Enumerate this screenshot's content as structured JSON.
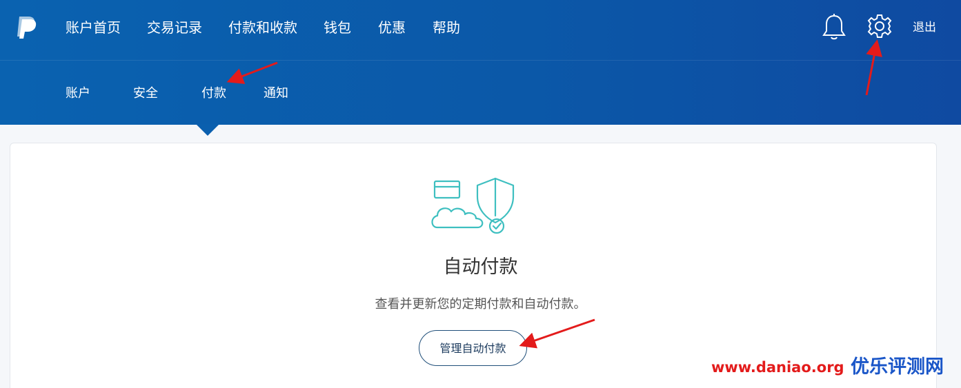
{
  "brand": {
    "logo_icon": "paypal-logo-icon"
  },
  "main_nav": [
    {
      "label": "账户首页"
    },
    {
      "label": "交易记录"
    },
    {
      "label": "付款和收款"
    },
    {
      "label": "钱包"
    },
    {
      "label": "优惠"
    },
    {
      "label": "帮助"
    }
  ],
  "header_actions": {
    "notifications_icon": "bell-icon",
    "settings_icon": "gear-icon",
    "logout_label": "退出"
  },
  "sub_nav": {
    "items": [
      {
        "label": "账户"
      },
      {
        "label": "安全"
      },
      {
        "label": "付款"
      },
      {
        "label": "通知"
      }
    ],
    "selected": "付款"
  },
  "card": {
    "illustration_icon": "card-cloud-shield-icon",
    "title": "自动付款",
    "description": "查看并更新您的定期付款和自动付款。",
    "button_label": "管理自动付款"
  },
  "annotations": {
    "arrow_color": "#e31b1b",
    "arrows": [
      "subnav-payments-arrow",
      "settings-arrow",
      "manage-button-arrow"
    ]
  },
  "watermark": {
    "url": "www.daniao.org",
    "site_name": "优乐评测网",
    "url_color": "#e31b1b",
    "name_color": "#1a56c8"
  },
  "colors": {
    "header_blue": "#0a62b0",
    "accent_teal": "#3ebfc0",
    "button_border": "#1f4e79"
  }
}
